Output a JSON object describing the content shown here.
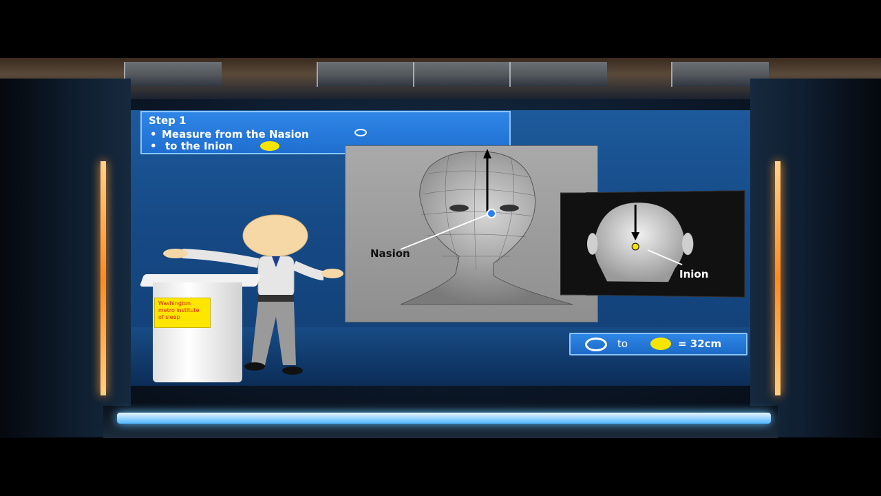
{
  "step": {
    "title": "Step 1",
    "bullet_1": "Measure from the Nasion",
    "bullet_2": "to the Inion",
    "bullet_marker": "•"
  },
  "labels": {
    "nasion": "Nasion",
    "inion": "Inion"
  },
  "result": {
    "to": "to",
    "value": "= 32cm"
  },
  "podium_sign": {
    "line_1": "Washington",
    "line_2": "metro institute",
    "line_3": "of sleep"
  },
  "colors": {
    "nasion_marker": "#2a7fff",
    "inion_marker": "#f5e500",
    "step_box": "#2f86e6",
    "screen": "#164a86"
  },
  "icons": {
    "nasion_symbol": "ring-icon",
    "inion_symbol": "yellow-dot-icon"
  }
}
